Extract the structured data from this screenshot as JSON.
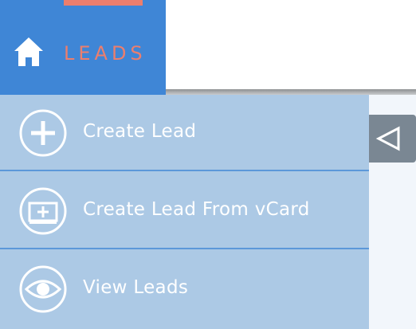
{
  "nav": {
    "label": "LEADS",
    "icon": "home-icon",
    "tab_color": "#3f86d6",
    "accent_color": "#ec7e6d"
  },
  "menu": {
    "background": "#acc9e5",
    "items": [
      {
        "label": "Create Lead",
        "icon": "plus-circle-icon"
      },
      {
        "label": "Create Lead From vCard",
        "icon": "vcard-add-icon"
      },
      {
        "label": "View Leads",
        "icon": "eye-icon"
      }
    ]
  },
  "collapse_toggle": {
    "icon": "triangle-left-icon"
  }
}
